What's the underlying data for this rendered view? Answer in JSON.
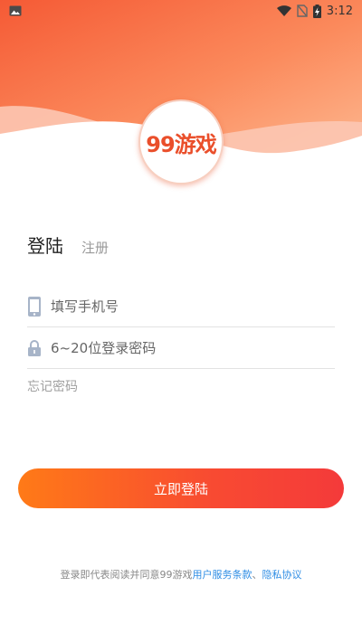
{
  "status_bar": {
    "time": "3:12"
  },
  "logo": {
    "text": "99游戏"
  },
  "tabs": {
    "login": "登陆",
    "register": "注册"
  },
  "form": {
    "phone_placeholder": "填写手机号",
    "password_placeholder": "6~20位登录密码",
    "forgot_password": "忘记密码"
  },
  "login_button": {
    "label": "立即登陆"
  },
  "agreement": {
    "prefix": "登录即代表阅读并同意99游戏",
    "terms_link": "用户服务条款",
    "separator": "、",
    "privacy_link": "隐私协议"
  },
  "colors": {
    "accent_start": "#ff7a17",
    "accent_end": "#f43a3a",
    "link": "#2f8de4",
    "icon_gray": "#a7b4c8"
  },
  "icons": [
    "image-icon",
    "wifi-icon",
    "no-sim-icon",
    "battery-charging-icon",
    "phone-icon",
    "lock-icon"
  ]
}
